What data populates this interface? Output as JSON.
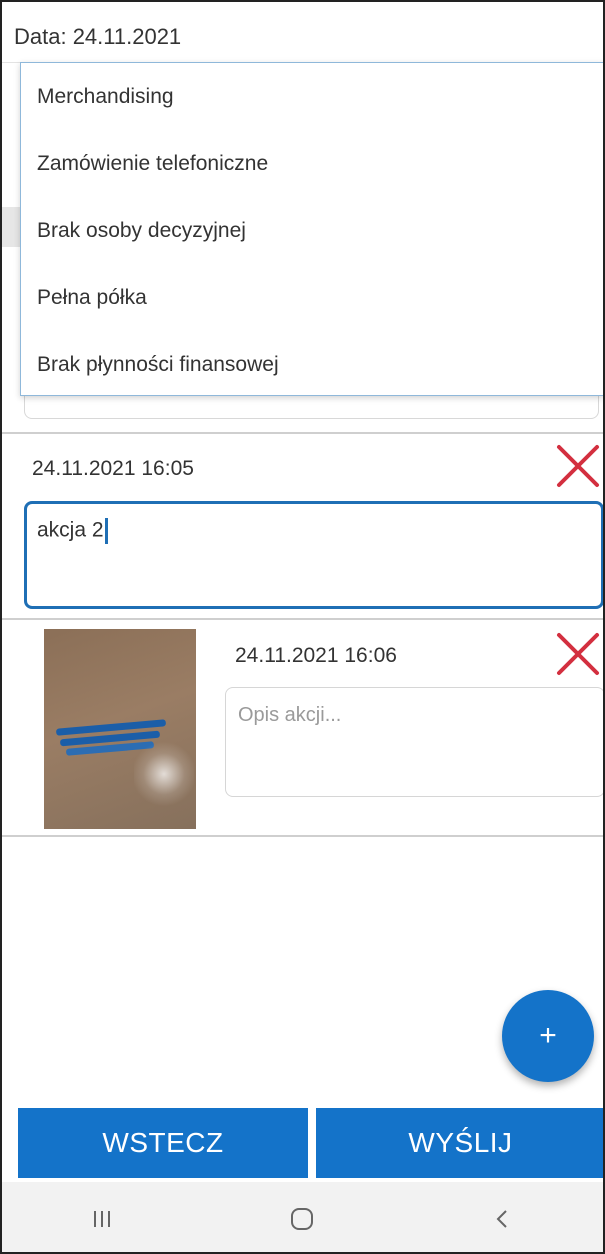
{
  "header": {
    "date_label": "Data: 24.11.2021"
  },
  "dropdown": {
    "items": [
      {
        "label": "Merchandising"
      },
      {
        "label": "Zamówienie telefoniczne"
      },
      {
        "label": "Brak osoby decyzyjnej"
      },
      {
        "label": "Pełna półka"
      },
      {
        "label": "Brak płynności finansowej"
      }
    ]
  },
  "entries": [
    {
      "timestamp": "24.11.2021 16:05",
      "description": "akcja 2",
      "has_photo": false
    },
    {
      "timestamp": "24.11.2021 16:06",
      "description": "",
      "placeholder": "Opis akcji...",
      "has_photo": true
    }
  ],
  "fab": {
    "icon": "plus-icon",
    "label": "+"
  },
  "buttons": {
    "back_label": "WSTECZ",
    "send_label": "WYŚLIJ"
  },
  "icons": {
    "delete": "close-icon",
    "nav_recent": "recent-apps-icon",
    "nav_home": "home-icon",
    "nav_back": "back-icon"
  },
  "colors": {
    "accent": "#1473c9",
    "delete": "#d32f3f",
    "focus_border": "#1f6fb5"
  }
}
